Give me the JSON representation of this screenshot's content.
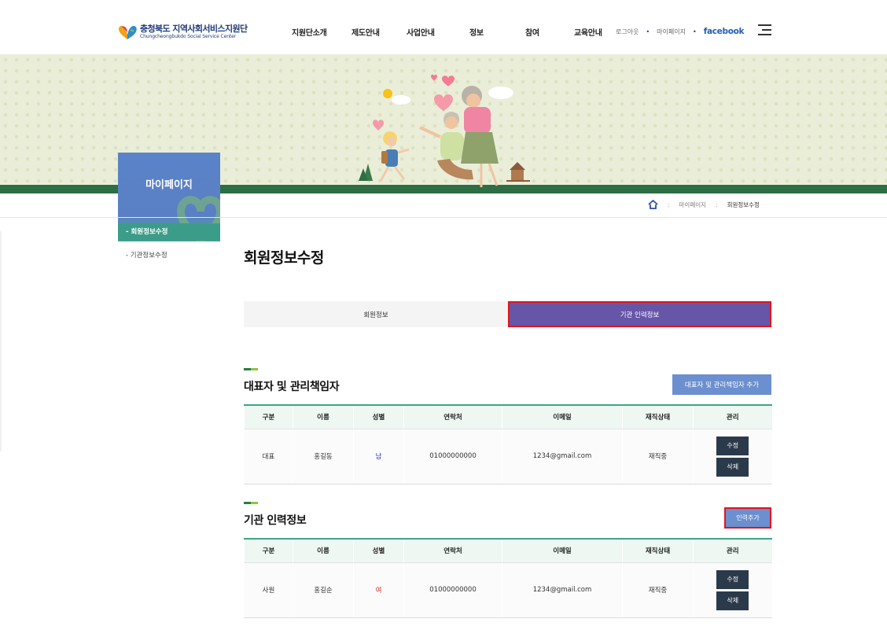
{
  "header": {
    "logo_ko": "충청북도 지역사회서비스지원단",
    "logo_en": "Chungcheongbukdo Social Service Center",
    "nav": [
      "지원단소개",
      "제도안내",
      "사업안내",
      "정보",
      "참여",
      "교육안내"
    ],
    "util": {
      "login": "로그아웃",
      "mypage": "마이페이지",
      "facebook": "facebook"
    }
  },
  "lnb": {
    "title": "마이페이지",
    "items": [
      {
        "label": "-  회원정보수정",
        "active": true
      },
      {
        "label": "-  기관정보수정",
        "active": false
      }
    ]
  },
  "breadcrumb": {
    "sep": ":",
    "items": [
      "마이페이지",
      "회원정보수정"
    ]
  },
  "page": {
    "title": "회원정보수정",
    "tabs": [
      "회원정보",
      "기관 인력정보"
    ],
    "active_tab": 1
  },
  "section1": {
    "title": "대표자 및 관리책임자",
    "add_button": "대표자 및 관리책임자 추가",
    "columns": [
      "구분",
      "이름",
      "성별",
      "연락처",
      "이메일",
      "재직상태",
      "관리"
    ],
    "rows": [
      {
        "type": "대표",
        "name": "홍길동",
        "gender": "남",
        "phone": "01000000000",
        "email": "1234@gmail.com",
        "status": "재직중",
        "edit": "수정",
        "delete": "삭제"
      }
    ]
  },
  "section2": {
    "title": "기관 인력정보",
    "add_button": "인력추가",
    "columns": [
      "구분",
      "이름",
      "성별",
      "연락처",
      "이메일",
      "재직상태",
      "관리"
    ],
    "rows": [
      {
        "type": "사원",
        "name": "홍길순",
        "gender": "여",
        "phone": "01000000000",
        "email": "1234@gmail.com",
        "status": "재직중",
        "edit": "수정",
        "delete": "삭제"
      }
    ]
  },
  "colors": {
    "accent_purple": "#6656a8",
    "button_blue": "#6b8fcf",
    "table_top_green": "#3ea487",
    "banner_green": "#2d6e45",
    "highlight_red": "#e0141e",
    "male_blue": "#2a2ad0",
    "female_red": "#e02a2a"
  },
  "icons": [
    "logo-heart-icon",
    "hamburger-menu-icon",
    "home-icon"
  ]
}
